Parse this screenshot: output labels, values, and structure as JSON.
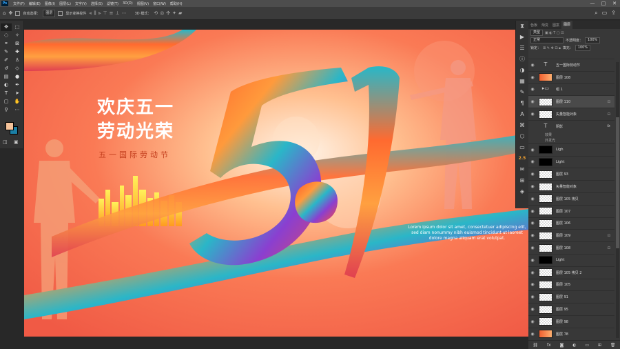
{
  "app": {
    "logo": "Ps"
  },
  "menu": [
    "文件(F)",
    "编辑(E)",
    "图像(I)",
    "图层(L)",
    "文字(Y)",
    "选择(S)",
    "滤镜(T)",
    "3D(D)",
    "视图(V)",
    "窗口(W)",
    "帮助(H)"
  ],
  "window_buttons": [
    "—",
    "□",
    "✕"
  ],
  "options": {
    "auto_select_label": "自动选择：",
    "auto_select_value": "图层",
    "show_transform_label": "显示变换控件",
    "mode_3d_label": "3D 模式："
  },
  "colors": {
    "foreground": "#f4c299",
    "background": "#1b7fa5"
  },
  "artwork": {
    "headline_line1": "欢庆五一",
    "headline_line2": "劳动光荣",
    "subtitle": "五一国际劳动节",
    "lorem_line1": "Lorem ipsum dolor sit amet, consectetuer adipiscing elit,",
    "lorem_line2": "sed diam nonummy nibh euismod tincidunt ut laoreet",
    "lorem_line3": "dolore magna aliquam erat volutpat."
  },
  "vstrip": {
    "badge": "2.5"
  },
  "panel": {
    "tabs": [
      "色板",
      "渐变",
      "图案",
      "图层"
    ],
    "kind_label": "类型",
    "blend_mode": "正常",
    "opacity_label": "不透明度：",
    "opacity": "100%",
    "lock_label": "锁定：",
    "fill_label": "填充：",
    "fill": "100%",
    "effects_label": "效果",
    "outer_glow_label": "外发光"
  },
  "layers": [
    {
      "name": "五一国际劳动节",
      "thumb": "text"
    },
    {
      "name": "图层 108",
      "thumb": "grad"
    },
    {
      "name": "组 1",
      "thumb": "folder"
    },
    {
      "name": "图层 110",
      "thumb": "chk",
      "selected": true,
      "locked": true
    },
    {
      "name": "矢量智能对象",
      "thumb": "chk",
      "locked": true
    },
    {
      "name": "阴影",
      "thumb": "text",
      "fx": true
    },
    {
      "name": "Ligh",
      "thumb": "black"
    },
    {
      "name": "Light",
      "thumb": "black"
    },
    {
      "name": "图层 93",
      "thumb": "chk"
    },
    {
      "name": "矢量智能对象",
      "thumb": "chk"
    },
    {
      "name": "图层 105 拷贝",
      "thumb": "chk"
    },
    {
      "name": "图层 107",
      "thumb": "chk"
    },
    {
      "name": "图层 106",
      "thumb": "chk"
    },
    {
      "name": "图层 109",
      "thumb": "chk",
      "locked": true
    },
    {
      "name": "图层 108",
      "thumb": "chk",
      "locked": true
    },
    {
      "name": "Light",
      "thumb": "black"
    },
    {
      "name": "图层 105 拷贝 2",
      "thumb": "chk"
    },
    {
      "name": "图层 105",
      "thumb": "chk"
    },
    {
      "name": "图层 91",
      "thumb": "chk"
    },
    {
      "name": "图层 95",
      "thumb": "chk"
    },
    {
      "name": "图层 98",
      "thumb": "chk"
    },
    {
      "name": "图层 78",
      "thumb": "grad"
    }
  ]
}
